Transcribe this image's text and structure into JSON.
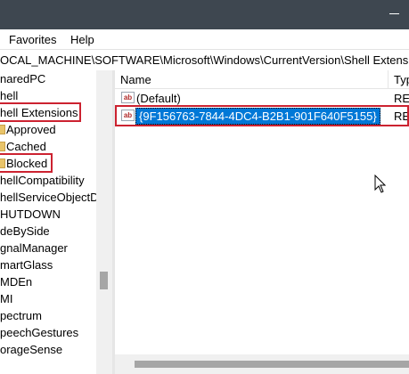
{
  "menu": {
    "favorites": "Favorites",
    "help": "Help"
  },
  "address": "OCAL_MACHINE\\SOFTWARE\\Microsoft\\Windows\\CurrentVersion\\Shell Extensions",
  "tree": {
    "items": [
      {
        "label": "naredPC"
      },
      {
        "label": "hell"
      },
      {
        "label": "hell Extensions"
      },
      {
        "label": "Approved"
      },
      {
        "label": "Cached"
      },
      {
        "label": "Blocked"
      },
      {
        "label": "hellCompatibility"
      },
      {
        "label": "hellServiceObjectD"
      },
      {
        "label": "HUTDOWN"
      },
      {
        "label": "deBySide"
      },
      {
        "label": "gnalManager"
      },
      {
        "label": "martGlass"
      },
      {
        "label": "MDEn"
      },
      {
        "label": "MI"
      },
      {
        "label": "pectrum"
      },
      {
        "label": "peechGestures"
      },
      {
        "label": "orageSense"
      }
    ]
  },
  "list": {
    "columns": {
      "name": "Name",
      "type": "Typ"
    },
    "rows": [
      {
        "icon": "ab",
        "name": "(Default)",
        "type": "REG"
      },
      {
        "icon": "ab",
        "name": "{9F156763-7844-4DC4-B2B1-901F640F5155}",
        "type": "REG"
      }
    ]
  },
  "colors": {
    "highlight": "#cc2230",
    "selection": "#0078d7",
    "titlebar": "#3e4750"
  }
}
